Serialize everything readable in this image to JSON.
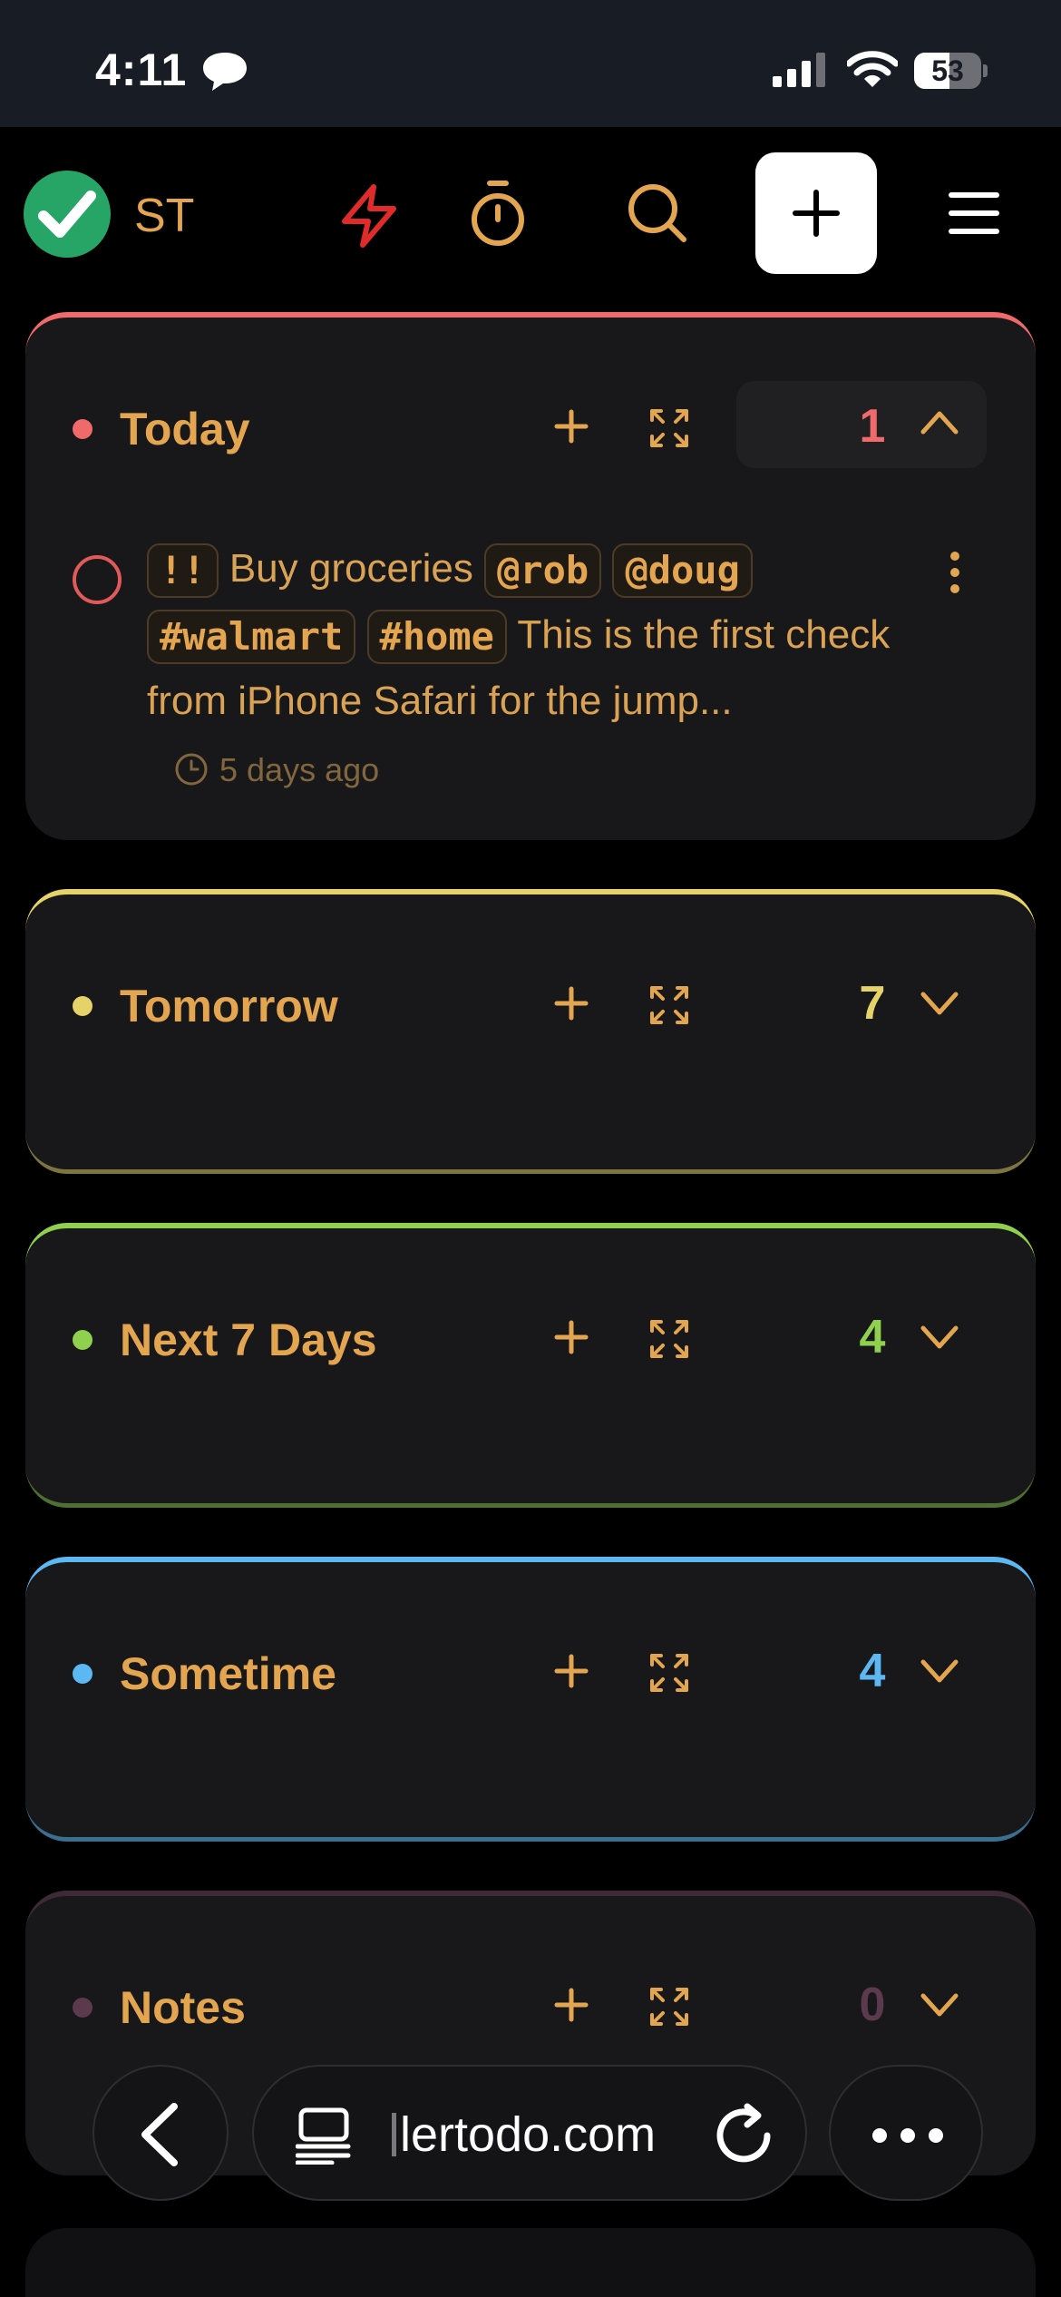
{
  "status_bar": {
    "time": "4:11",
    "battery": "53",
    "battery_level": 0.53
  },
  "app": {
    "initials": "ST"
  },
  "colors": {
    "accent": "#e3a550",
    "today": "#f0696b",
    "tomorrow": "#e5d36a",
    "next7": "#8fd14f",
    "sometime": "#5cb8f2",
    "notes": "#5a3a4c",
    "logo": "#27a567",
    "bolt": "#e02b2b"
  },
  "sections": [
    {
      "title": "Today",
      "count": "1",
      "expanded": true,
      "tasks": [
        {
          "priority": "!!",
          "text_before": "Buy groceries",
          "mentions": [
            "@rob",
            "@doug"
          ],
          "tags": [
            "#walmart",
            "#home"
          ],
          "text_after": "This is the first check from iPhone Safari for the jump...",
          "time": "5 days ago"
        }
      ]
    },
    {
      "title": "Tomorrow",
      "count": "7",
      "expanded": false
    },
    {
      "title": "Next 7 Days",
      "count": "4",
      "expanded": false
    },
    {
      "title": "Sometime",
      "count": "4",
      "expanded": false
    },
    {
      "title": "Notes",
      "count": "0",
      "expanded": false
    }
  ],
  "browser": {
    "url": "lertodo.com"
  },
  "icons": {
    "status": [
      "message-icon",
      "signal-icon",
      "wifi-icon",
      "battery-icon"
    ],
    "header": [
      "logo-check-icon",
      "bolt-icon",
      "timer-icon",
      "search-icon",
      "plus-icon",
      "menu-icon"
    ],
    "section": [
      "plus-icon",
      "expand-icon",
      "chevron-up-icon",
      "chevron-down-icon"
    ],
    "browser": [
      "back-icon",
      "tabs-icon",
      "reload-icon",
      "more-icon"
    ]
  }
}
